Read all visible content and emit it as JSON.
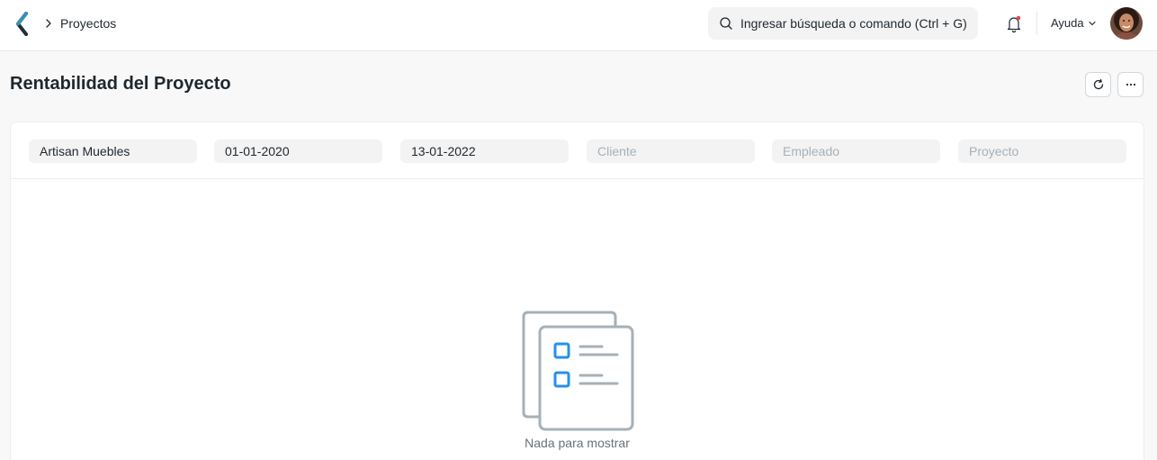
{
  "navbar": {
    "breadcrumb": "Proyectos",
    "search_placeholder": "Ingresar búsqueda o comando (Ctrl + G)",
    "help_label": "Ayuda"
  },
  "page": {
    "title": "Rentabilidad del Proyecto"
  },
  "filters": {
    "company": "Artisan Muebles",
    "from_date": "01-01-2020",
    "to_date": "13-01-2022",
    "customer_placeholder": "Cliente",
    "employee_placeholder": "Empleado",
    "project_placeholder": "Proyecto"
  },
  "report": {
    "empty_message": "Nada para mostrar"
  },
  "icons": [
    "app-logo",
    "chevron-right-icon",
    "search-icon",
    "bell-icon",
    "chevron-down-icon",
    "refresh-icon",
    "more-icon",
    "empty-list-icon"
  ],
  "colors": {
    "accent": "#2490ef",
    "notification_dot": "#e24c4c",
    "logo": "#1f6a8a"
  }
}
